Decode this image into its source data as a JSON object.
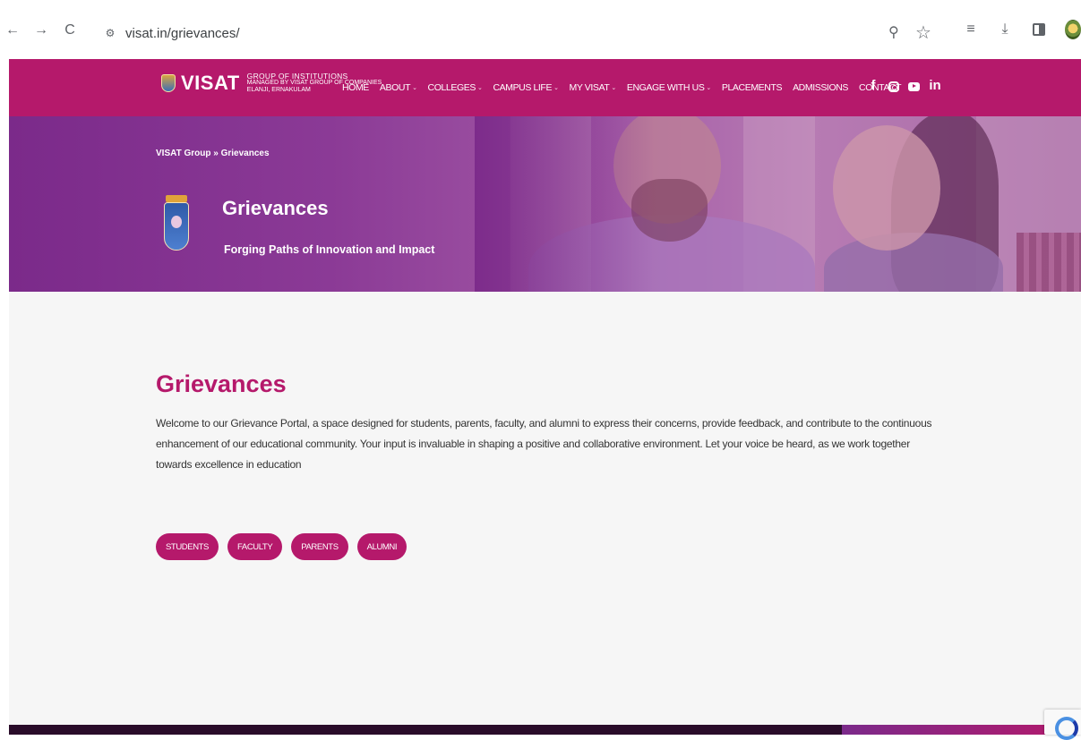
{
  "browser": {
    "url": "visat.in/grievances/",
    "nav_back": "←",
    "nav_forward": "→",
    "nav_reload": "C",
    "zoom_glyph": "⚲",
    "star_glyph": "☆",
    "reading_list_glyph": "≡",
    "download_glyph": "⤓"
  },
  "header": {
    "logo": "VISAT",
    "logo_sub1": "GROUP OF INSTITUTIONS",
    "logo_sub2": "MANAGED BY VISAT GROUP OF COMPANIES",
    "logo_sub3": "ELANJI, ERNAKULAM",
    "nav": [
      {
        "label": "HOME",
        "has_dropdown": false
      },
      {
        "label": "ABOUT",
        "has_dropdown": true
      },
      {
        "label": "COLLEGES",
        "has_dropdown": true
      },
      {
        "label": "CAMPUS LIFE",
        "has_dropdown": true
      },
      {
        "label": "MY VISAT",
        "has_dropdown": true
      },
      {
        "label": "ENGAGE WITH US",
        "has_dropdown": true
      },
      {
        "label": "PLACEMENTS",
        "has_dropdown": false
      },
      {
        "label": "ADMISSIONS",
        "has_dropdown": false
      },
      {
        "label": "CONTACT",
        "has_dropdown": false
      }
    ],
    "dropdown_caret": "⌄",
    "socials": [
      "facebook-icon",
      "instagram-icon",
      "youtube-icon",
      "linkedin-icon"
    ],
    "facebook_glyph": "f",
    "linkedin_glyph": "in"
  },
  "hero": {
    "breadcrumb": "VISAT Group » Grievances",
    "title": "Grievances",
    "subtitle": "Forging Paths of Innovation and Impact"
  },
  "main": {
    "title": "Grievances",
    "description": "Welcome to our Grievance Portal, a space designed for students, parents, faculty, and alumni to express their concerns, provide feedback, and contribute to the continuous enhancement of our educational community. Your input is invaluable in shaping a positive and collaborative environment. Let your voice be heard, as we work together towards excellence in education",
    "buttons": [
      "STUDENTS",
      "FACULTY",
      "PARENTS",
      "ALUMNI"
    ]
  },
  "colors": {
    "brand": "#b5196b",
    "hero_purple": "#7b2a8a",
    "footer": "#2a0c2a"
  }
}
